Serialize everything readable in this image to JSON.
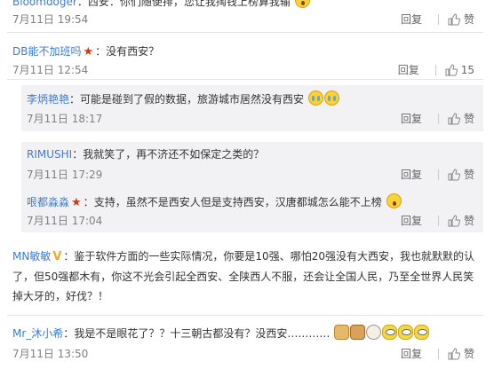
{
  "comments": [
    {
      "user": "Bloomdoger",
      "text": "西安：你们随便排，您让我掏钱上榜算我输",
      "time": "7月11日 19:54",
      "reply_label": "回复",
      "like_label": "赞",
      "like_count": ""
    },
    {
      "user": "DB能不加班吗",
      "text": "没有西安？",
      "time": "7月11日 12:54",
      "reply_label": "回复",
      "like_label": "",
      "like_count": "15"
    },
    {
      "user": "李炳艳艳",
      "text": "可能是碰到了假的数据，旅游城市居然没有西安",
      "time": "7月11日 18:17",
      "reply_label": "回复",
      "like_label": "赞",
      "like_count": ""
    },
    {
      "user": "RIMUSHI",
      "text": "我就笑了，再不济还不如保定之类的？",
      "time": "7月11日 17:29",
      "reply_label": "回复",
      "like_label": "赞",
      "like_count": ""
    },
    {
      "user": "哏都淼淼",
      "text": "支持，虽然不是西安人但是支持西安，汉唐都城怎么能不上榜",
      "time": "7月11日 17:04",
      "reply_label": "回复",
      "like_label": "赞",
      "like_count": ""
    },
    {
      "user": "MN敏敏",
      "text": "鉴于软件方面的一些实际情况，你要是10强、哪怕20强没有大西安，我也就默默的认了，但50强都木有，你这不光会引起全西安、全陕西人不服，还会让全国人民，乃至全世界人民笑掉大牙的，好伐？！",
      "time": "7月11日 14:54",
      "reply_label": "回复",
      "like_label": "赞",
      "like_count": ""
    },
    {
      "user": "Mr_沐小希",
      "text": "我是不是眼花了？？十三朝古都没有？没西安…………",
      "time": "7月11日 13:50",
      "reply_label": "回复",
      "like_label": "赞",
      "like_count": ""
    }
  ],
  "separator": "：",
  "colors": {
    "user_link": "#3d7bd6",
    "text": "#333333",
    "meta": "#808080",
    "reply_bg": "#f2f2f5",
    "star_badge": "#e0320a",
    "vip_badge": "#f5a623"
  },
  "icons": [
    "thumbs-up-icon",
    "star-badge-icon",
    "vip-badge-icon",
    "emoji-icon"
  ]
}
